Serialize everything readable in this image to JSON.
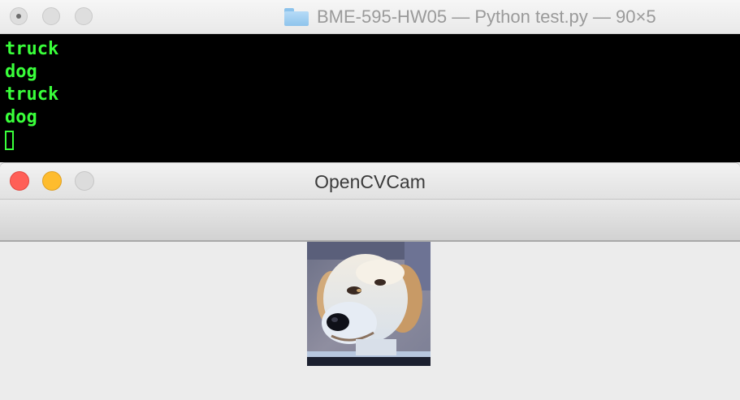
{
  "terminal": {
    "title": "BME-595-HW05 — Python test.py — 90×5",
    "lines": [
      "truck",
      "dog",
      "truck",
      "dog"
    ]
  },
  "opencv_window": {
    "title": "OpenCVCam",
    "image_icon": "dog-photo",
    "colors": {
      "close": "#ff5f57",
      "minimize": "#febc2e",
      "zoom": "#dcdcdc"
    }
  },
  "colors": {
    "terminal_text": "#39ff3a",
    "terminal_background": "#000000"
  }
}
